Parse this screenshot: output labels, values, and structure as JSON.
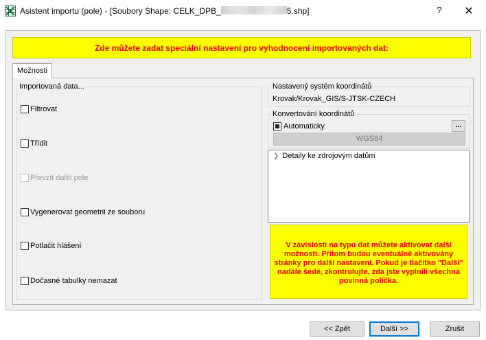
{
  "window": {
    "title_prefix": "Asistent importu (pole) - [Soubory Shape: CELK_DPB_",
    "title_suffix": "5.shp]",
    "help_label": "?",
    "close_label": "✕",
    "icon": "excel-grid-icon"
  },
  "banner": {
    "text": "Zde můžete zadat speciální nastavení pro vyhodnocení importovaných dat:"
  },
  "tabs": [
    {
      "label": "Možnosti",
      "selected": true
    }
  ],
  "import_group": {
    "legend": "Importovaná data...",
    "options": [
      {
        "label": "Filtrovat",
        "checked": false,
        "enabled": true
      },
      {
        "label": "Třídit",
        "checked": false,
        "enabled": true
      },
      {
        "label": "Převzít další pole",
        "checked": false,
        "enabled": false
      },
      {
        "label": "Vygenerovat geometrii ze souboru",
        "checked": false,
        "enabled": true
      },
      {
        "label": "Potlačit hlášení",
        "checked": false,
        "enabled": true
      },
      {
        "label": "Dočasné tabulky nemazat",
        "checked": false,
        "enabled": true
      }
    ]
  },
  "coord_system": {
    "legend": "Nastavený systém koordinátů",
    "value": "Krovak/Krovak_GIS/S-JTSK-CZECH"
  },
  "conversion": {
    "legend": "Konvertování koordinátů",
    "auto_label": "Automaticky",
    "auto_state": "indeterminate",
    "browse_label": "...",
    "target": "WGS84"
  },
  "tree": {
    "item_label": "Detaily ke zdrojovým datům"
  },
  "note": {
    "text": "V závislosti na typu dat můžete aktivovat další možnosti. Přitom budou eventuálně aktivovány stránky pro další nastavení. Pokud je tlačítko \"Další\" nadále šedé, zkontrolujte, zda jste vyplnili všechna povinná políčka."
  },
  "buttons": {
    "back": "<< Zpět",
    "next": "Další >>",
    "cancel": "Zrušit"
  },
  "colors": {
    "highlight": "#ffff00",
    "warning_text": "#e00000",
    "default_button_border": "#0078d7"
  }
}
